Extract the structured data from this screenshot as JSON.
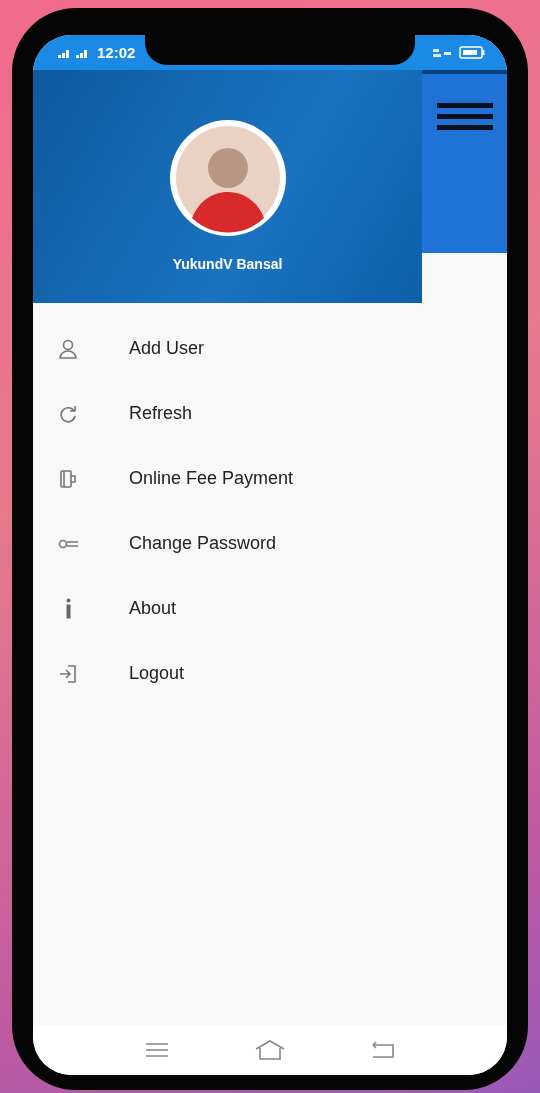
{
  "status_bar": {
    "time": "12:02"
  },
  "drawer_header": {
    "user_name": "YukundV Bansal"
  },
  "menu": [
    {
      "label": "Add User"
    },
    {
      "label": "Refresh"
    },
    {
      "label": "Online Fee Payment"
    },
    {
      "label": "Change Password"
    },
    {
      "label": "About"
    },
    {
      "label": "Logout"
    }
  ]
}
